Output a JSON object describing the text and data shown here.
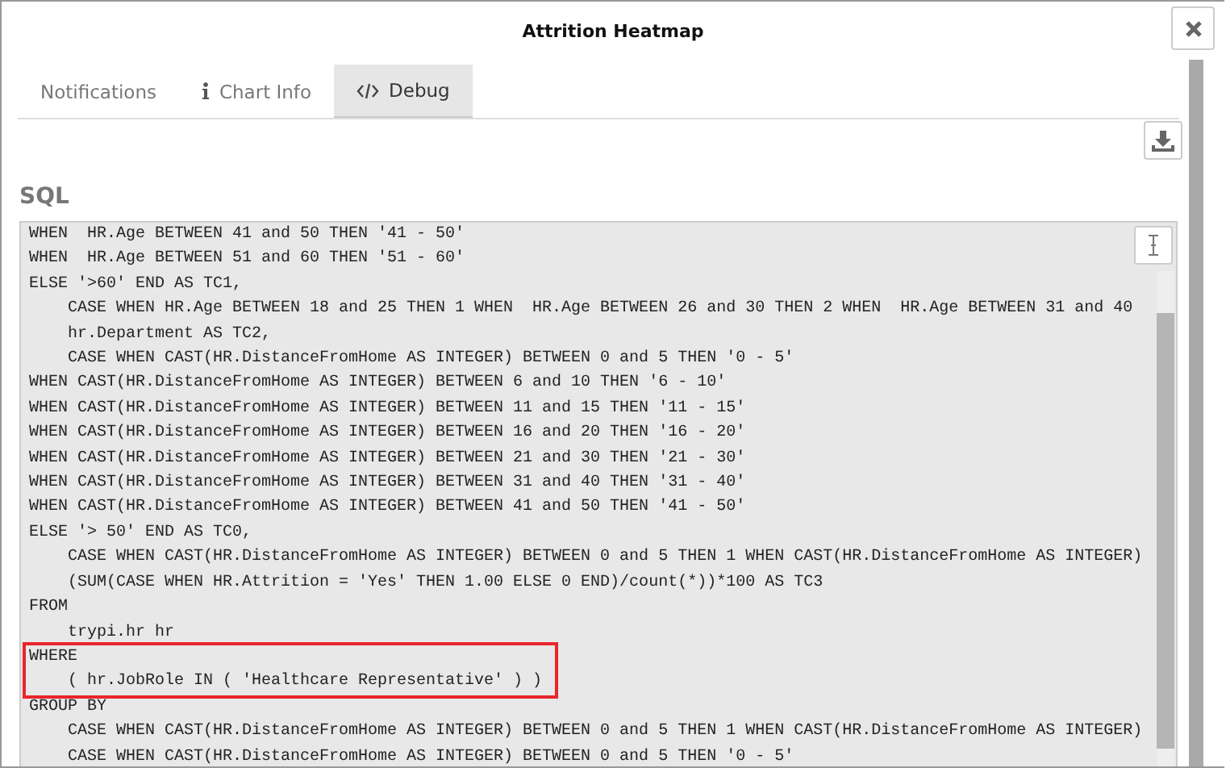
{
  "window": {
    "title": "Attrition Heatmap"
  },
  "tabs": [
    {
      "label": "Notifications",
      "selected": false
    },
    {
      "label": "Chart Info",
      "selected": false
    },
    {
      "label": "Debug",
      "selected": true
    }
  ],
  "section_title": "SQL",
  "sql_blocks": [
    {
      "highlighted": false,
      "lines": [
        "WHEN  HR.Age BETWEEN 41 and 50 THEN '41 - 50'",
        "WHEN  HR.Age BETWEEN 51 and 60 THEN '51 - 60'",
        "ELSE '>60' END AS TC1,",
        "    CASE WHEN HR.Age BETWEEN 18 and 25 THEN 1 WHEN  HR.Age BETWEEN 26 and 30 THEN 2 WHEN  HR.Age BETWEEN 31 and 40",
        "    hr.Department AS TC2,",
        "    CASE WHEN CAST(HR.DistanceFromHome AS INTEGER) BETWEEN 0 and 5 THEN '0 - 5'",
        "WHEN CAST(HR.DistanceFromHome AS INTEGER) BETWEEN 6 and 10 THEN '6 - 10'",
        "WHEN CAST(HR.DistanceFromHome AS INTEGER) BETWEEN 11 and 15 THEN '11 - 15'",
        "WHEN CAST(HR.DistanceFromHome AS INTEGER) BETWEEN 16 and 20 THEN '16 - 20'",
        "WHEN CAST(HR.DistanceFromHome AS INTEGER) BETWEEN 21 and 30 THEN '21 - 30'",
        "WHEN CAST(HR.DistanceFromHome AS INTEGER) BETWEEN 31 and 40 THEN '31 - 40'",
        "WHEN CAST(HR.DistanceFromHome AS INTEGER) BETWEEN 41 and 50 THEN '41 - 50'",
        "ELSE '> 50' END AS TC0,",
        "    CASE WHEN CAST(HR.DistanceFromHome AS INTEGER) BETWEEN 0 and 5 THEN 1 WHEN CAST(HR.DistanceFromHome AS INTEGER)",
        "    (SUM(CASE WHEN HR.Attrition = 'Yes' THEN 1.00 ELSE 0 END)/count(*))*100 AS TC3",
        "FROM",
        "    trypi.hr hr"
      ]
    },
    {
      "highlighted": true,
      "lines": [
        "WHERE",
        "    ( hr.JobRole IN ( 'Healthcare Representative' ) )"
      ]
    },
    {
      "highlighted": false,
      "lines": [
        "GROUP BY",
        "    CASE WHEN CAST(HR.DistanceFromHome AS INTEGER) BETWEEN 0 and 5 THEN 1 WHEN CAST(HR.DistanceFromHome AS INTEGER)",
        "    CASE WHEN CAST(HR.DistanceFromHome AS INTEGER) BETWEEN 0 and 5 THEN '0 - 5'"
      ]
    }
  ]
}
